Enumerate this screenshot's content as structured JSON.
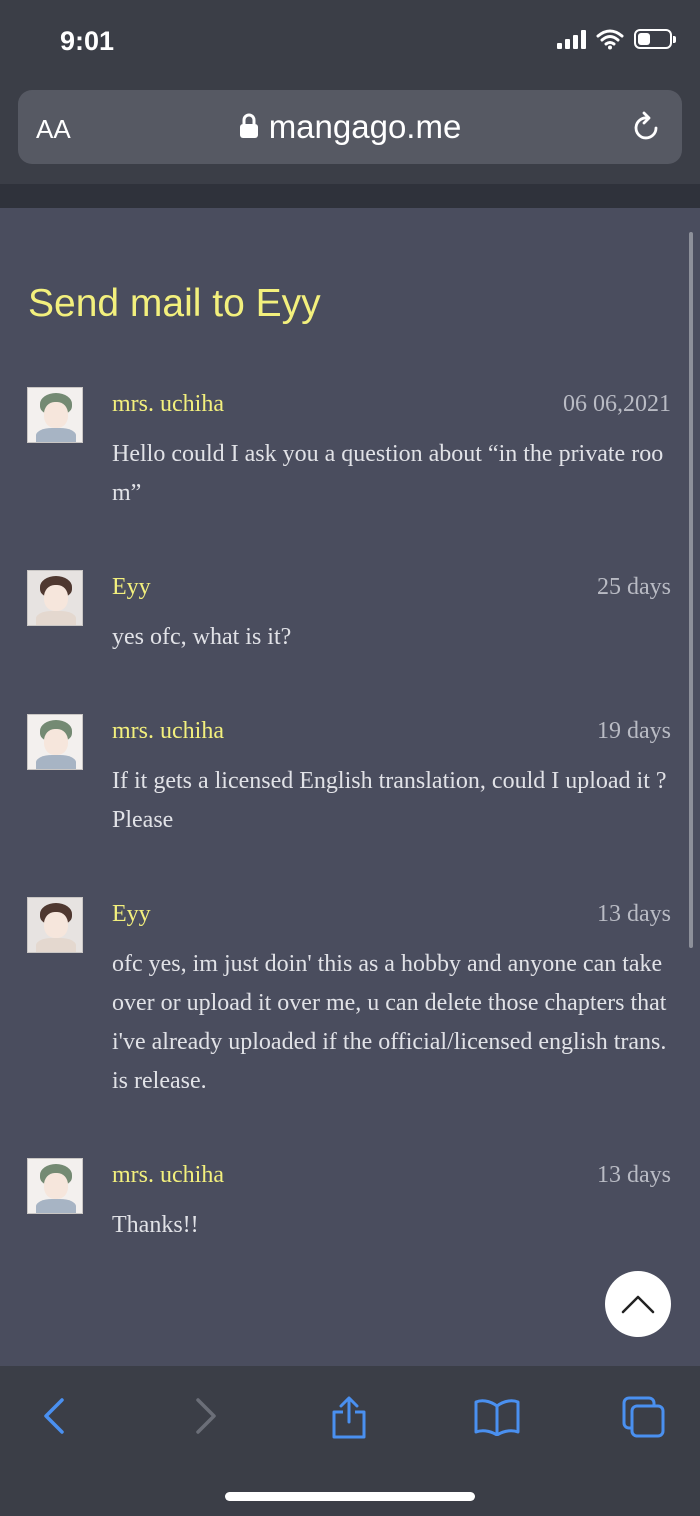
{
  "status": {
    "time": "9:01"
  },
  "browser": {
    "aa_label": "AA",
    "url": "mangago.me"
  },
  "page": {
    "title": "Send mail to Eyy"
  },
  "messages": [
    {
      "sender": "mrs. uchiha",
      "date": "06 06,2021",
      "text": "Hello could I ask you a question about “in the private room”",
      "avatar": "green"
    },
    {
      "sender": "Eyy",
      "date": "25 days",
      "text": "yes ofc, what is it?",
      "avatar": "dark"
    },
    {
      "sender": "mrs. uchiha",
      "date": "19 days",
      "text": "If it gets a licensed English translation, could I upload it ? Please",
      "avatar": "green"
    },
    {
      "sender": "Eyy",
      "date": "13 days",
      "text": "ofc yes, im just doin' this as a hobby and anyone can take over or upload it over me, u can delete those chapters that i've already uploaded if the official/licensed english trans. is release.",
      "avatar": "dark"
    },
    {
      "sender": "mrs. uchiha",
      "date": "13 days",
      "text": "Thanks!!",
      "avatar": "green"
    }
  ],
  "toolbar": {
    "icons": [
      "back-icon",
      "forward-icon",
      "share-icon",
      "bookmarks-icon",
      "tabs-icon"
    ]
  },
  "colors": {
    "accent_yellow": "#f3f07d",
    "background": "#4a4d5e",
    "chrome": "#3b3e47",
    "ios_blue": "#4a90f0"
  }
}
